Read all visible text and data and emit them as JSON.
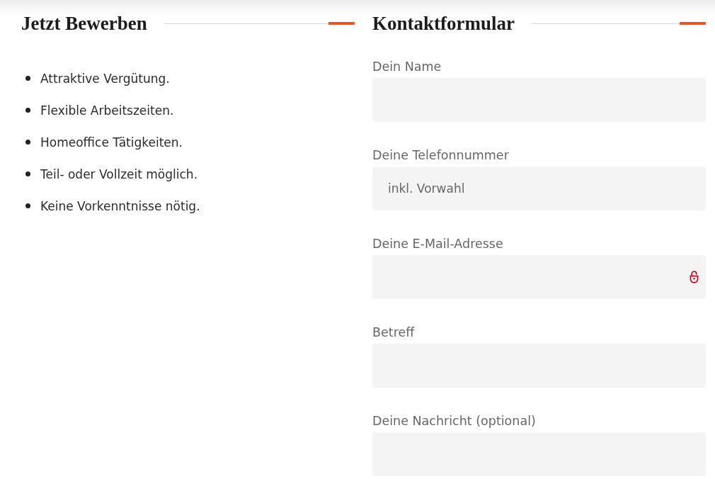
{
  "apply": {
    "title": "Jetzt Bewerben",
    "benefits": [
      "Attraktive Vergütung.",
      "Flexible Arbeitszeiten.",
      "Homeoffice Tätigkeiten.",
      "Teil- oder Vollzeit möglich.",
      "Keine Vorkenntnisse nötig."
    ]
  },
  "contact": {
    "title": "Kontaktformular",
    "fields": [
      {
        "label": "Dein Name",
        "kind": "plain"
      },
      {
        "label": "Deine Telefonnummer",
        "placeholder": "inkl. Vorwahl",
        "kind": "plain"
      },
      {
        "label": "Deine E-Mail-Adresse",
        "kind": "secured"
      },
      {
        "label": "Betreff",
        "kind": "plain"
      },
      {
        "label": "Deine Nachricht (optional)",
        "kind": "plain"
      }
    ]
  }
}
